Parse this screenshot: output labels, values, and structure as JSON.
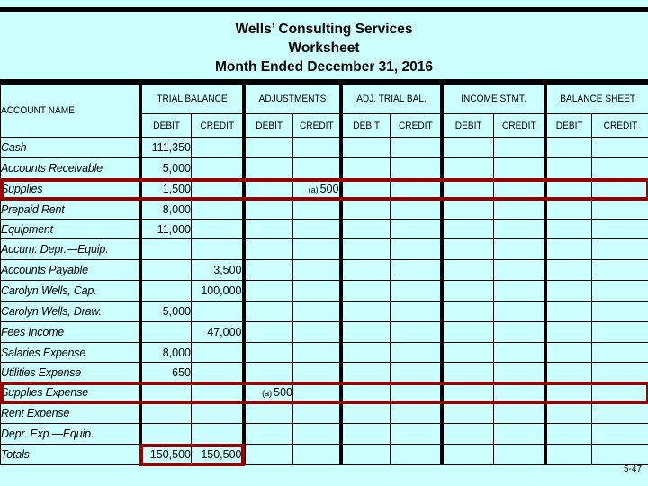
{
  "slide": {
    "page_number": "5-47",
    "background_color": "#ccffff",
    "highlight_color": "#990000"
  },
  "title": {
    "line1": "Wells’ Consulting Services",
    "line2": "Worksheet",
    "line3": "Month Ended December 31, 2016"
  },
  "table": {
    "account_header": "ACCOUNT NAME",
    "groups": [
      {
        "label": "TRIAL BALANCE"
      },
      {
        "label": "ADJUSTMENTS"
      },
      {
        "label": "ADJ. TRIAL BAL."
      },
      {
        "label": "INCOME STMT."
      },
      {
        "label": "BALANCE SHEET"
      }
    ],
    "sub_headers": {
      "debit": "DEBIT",
      "credit": "CREDIT"
    },
    "rows": [
      {
        "account": "Cash",
        "tb_debit": "111,350",
        "tb_credit": "",
        "adj_debit": "",
        "adj_debit_ref": "",
        "adj_credit": "",
        "adj_credit_ref": "",
        "atb_debit": "",
        "atb_credit": "",
        "is_debit": "",
        "is_credit": "",
        "bs_debit": "",
        "bs_credit": "",
        "short": false
      },
      {
        "account": "Accounts Receivable",
        "tb_debit": "5,000",
        "tb_credit": "",
        "adj_debit": "",
        "adj_debit_ref": "",
        "adj_credit": "",
        "adj_credit_ref": "",
        "atb_debit": "",
        "atb_credit": "",
        "is_debit": "",
        "is_credit": "",
        "bs_debit": "",
        "bs_credit": "",
        "short": false
      },
      {
        "account": "Supplies",
        "tb_debit": "1,500",
        "tb_credit": "",
        "adj_debit": "",
        "adj_debit_ref": "",
        "adj_credit": "500",
        "adj_credit_ref": "(a)",
        "atb_debit": "",
        "atb_credit": "",
        "is_debit": "",
        "is_credit": "",
        "bs_debit": "",
        "bs_credit": "",
        "short": false
      },
      {
        "account": "Prepaid Rent",
        "tb_debit": "8,000",
        "tb_credit": "",
        "adj_debit": "",
        "adj_debit_ref": "",
        "adj_credit": "",
        "adj_credit_ref": "",
        "atb_debit": "",
        "atb_credit": "",
        "is_debit": "",
        "is_credit": "",
        "bs_debit": "",
        "bs_credit": "",
        "short": true
      },
      {
        "account": "Equipment",
        "tb_debit": "11,000",
        "tb_credit": "",
        "adj_debit": "",
        "adj_debit_ref": "",
        "adj_credit": "",
        "adj_credit_ref": "",
        "atb_debit": "",
        "atb_credit": "",
        "is_debit": "",
        "is_credit": "",
        "bs_debit": "",
        "bs_credit": "",
        "short": true
      },
      {
        "account": "Accum. Depr.—Equip.",
        "tb_debit": "",
        "tb_credit": "",
        "adj_debit": "",
        "adj_debit_ref": "",
        "adj_credit": "",
        "adj_credit_ref": "",
        "atb_debit": "",
        "atb_credit": "",
        "is_debit": "",
        "is_credit": "",
        "bs_debit": "",
        "bs_credit": "",
        "short": false
      },
      {
        "account": "Accounts Payable",
        "tb_debit": "",
        "tb_credit": "3,500",
        "adj_debit": "",
        "adj_debit_ref": "",
        "adj_credit": "",
        "adj_credit_ref": "",
        "atb_debit": "",
        "atb_credit": "",
        "is_debit": "",
        "is_credit": "",
        "bs_debit": "",
        "bs_credit": "",
        "short": false
      },
      {
        "account": "Carolyn Wells, Cap.",
        "tb_debit": "",
        "tb_credit": "100,000",
        "adj_debit": "",
        "adj_debit_ref": "",
        "adj_credit": "",
        "adj_credit_ref": "",
        "atb_debit": "",
        "atb_credit": "",
        "is_debit": "",
        "is_credit": "",
        "bs_debit": "",
        "bs_credit": "",
        "short": false
      },
      {
        "account": "Carolyn Wells, Draw.",
        "tb_debit": "5,000",
        "tb_credit": "",
        "adj_debit": "",
        "adj_debit_ref": "",
        "adj_credit": "",
        "adj_credit_ref": "",
        "atb_debit": "",
        "atb_credit": "",
        "is_debit": "",
        "is_credit": "",
        "bs_debit": "",
        "bs_credit": "",
        "short": false
      },
      {
        "account": "Fees Income",
        "tb_debit": "",
        "tb_credit": "47,000",
        "adj_debit": "",
        "adj_debit_ref": "",
        "adj_credit": "",
        "adj_credit_ref": "",
        "atb_debit": "",
        "atb_credit": "",
        "is_debit": "",
        "is_credit": "",
        "bs_debit": "",
        "bs_credit": "",
        "short": false
      },
      {
        "account": "Salaries Expense",
        "tb_debit": "8,000",
        "tb_credit": "",
        "adj_debit": "",
        "adj_debit_ref": "",
        "adj_credit": "",
        "adj_credit_ref": "",
        "atb_debit": "",
        "atb_credit": "",
        "is_debit": "",
        "is_credit": "",
        "bs_debit": "",
        "bs_credit": "",
        "short": true
      },
      {
        "account": "Utilities Expense",
        "tb_debit": "650",
        "tb_credit": "",
        "adj_debit": "",
        "adj_debit_ref": "",
        "adj_credit": "",
        "adj_credit_ref": "",
        "atb_debit": "",
        "atb_credit": "",
        "is_debit": "",
        "is_credit": "",
        "bs_debit": "",
        "bs_credit": "",
        "short": true
      },
      {
        "account": "Supplies Expense",
        "tb_debit": "",
        "tb_credit": "",
        "adj_debit": "500",
        "adj_debit_ref": "(a)",
        "adj_credit": "",
        "adj_credit_ref": "",
        "atb_debit": "",
        "atb_credit": "",
        "is_debit": "",
        "is_credit": "",
        "bs_debit": "",
        "bs_credit": "",
        "short": false
      },
      {
        "account": "Rent Expense",
        "tb_debit": "",
        "tb_credit": "",
        "adj_debit": "",
        "adj_debit_ref": "",
        "adj_credit": "",
        "adj_credit_ref": "",
        "atb_debit": "",
        "atb_credit": "",
        "is_debit": "",
        "is_credit": "",
        "bs_debit": "",
        "bs_credit": "",
        "short": false
      },
      {
        "account": "Depr. Exp.—Equip.",
        "tb_debit": "",
        "tb_credit": "",
        "adj_debit": "",
        "adj_debit_ref": "",
        "adj_credit": "",
        "adj_credit_ref": "",
        "atb_debit": "",
        "atb_credit": "",
        "is_debit": "",
        "is_credit": "",
        "bs_debit": "",
        "bs_credit": "",
        "short": false
      },
      {
        "account": "Totals",
        "tb_debit": "150,500",
        "tb_credit": "150,500",
        "adj_debit": "",
        "adj_debit_ref": "",
        "adj_credit": "",
        "adj_credit_ref": "",
        "atb_debit": "",
        "atb_credit": "",
        "is_debit": "",
        "is_credit": "",
        "bs_debit": "",
        "bs_credit": "",
        "short": false
      }
    ],
    "highlighted_rows": [
      "Supplies",
      "Supplies Expense"
    ],
    "highlighted_totals": "Totals"
  }
}
